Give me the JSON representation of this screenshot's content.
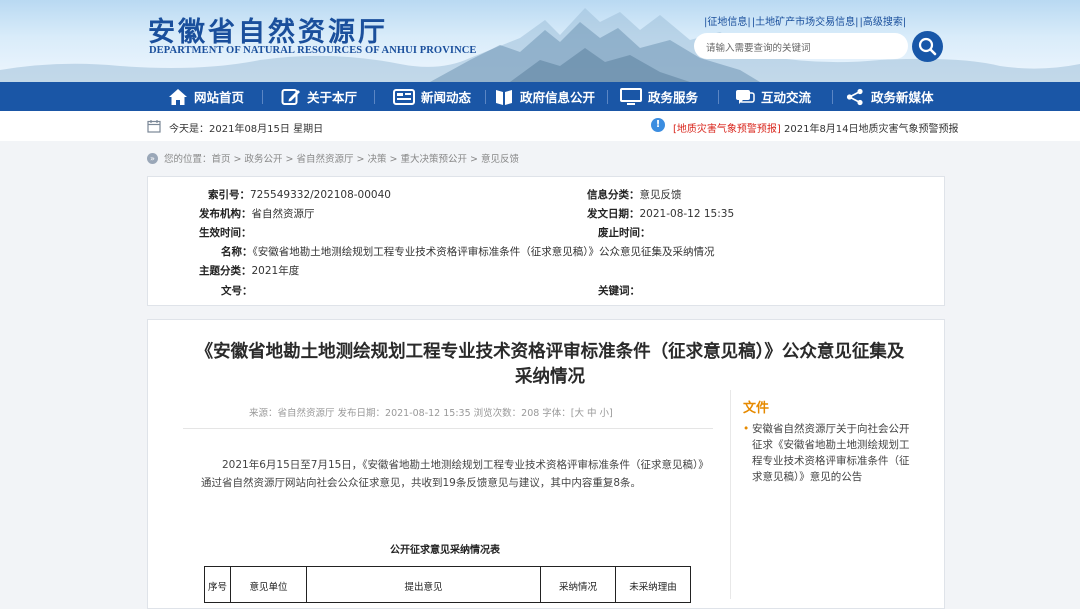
{
  "header": {
    "title_cn": "安徽省自然资源厅",
    "title_en": "DEPARTMENT OF NATURAL RESOURCES OF ANHUI PROVINCE",
    "links": [
      "|征地信息|",
      "|土地矿产市场交易信息|",
      "|高级搜索|"
    ],
    "search_placeholder": "请输入需要查询的关键词"
  },
  "nav": {
    "items": [
      {
        "label": "网站首页",
        "icon": "home-icon"
      },
      {
        "label": "关于本厅",
        "icon": "edit-icon"
      },
      {
        "label": "新闻动态",
        "icon": "news-icon"
      },
      {
        "label": "政府信息公开",
        "icon": "book-icon"
      },
      {
        "label": "政务服务",
        "icon": "monitor-icon"
      },
      {
        "label": "互动交流",
        "icon": "chat-icon"
      },
      {
        "label": "政务新媒体",
        "icon": "share-icon"
      }
    ]
  },
  "info": {
    "date": "今天是：2021年08月15日 星期日",
    "alert_tag": "[地质灾害气象预警预报]",
    "alert_text": " 2021年8月14日地质灾害气象预警预报"
  },
  "breadcrumb": "您的位置：首页 > 政务公开 > 省自然资源厅 > 决策 > 重大决策预公开 > 意见反馈",
  "meta": {
    "index_label": "索引号：",
    "index_value": "725549332/202108-00040",
    "category_label": "信息分类：",
    "category_value": "意见反馈",
    "org_label": "发布机构：",
    "org_value": "省自然资源厅",
    "date_label": "发文日期：",
    "date_value": "2021-08-12 15:35",
    "effective_label": "生效时间：",
    "effective_value": "",
    "repeal_label": "废止时间：",
    "repeal_value": "",
    "name_label": "名称：",
    "name_value": "《安徽省地勘土地测绘规划工程专业技术资格评审标准条件（征求意见稿）》公众意见征集及采纳情况",
    "topic_label": "主题分类：",
    "topic_value": "2021年度",
    "docno_label": "文号：",
    "docno_value": "",
    "keywords_label": "关键词：",
    "keywords_value": ""
  },
  "article": {
    "title": "《安徽省地勘土地测绘规划工程专业技术资格评审标准条件（征求意见稿）》公众意见征集及采纳情况",
    "subline": "来源：省自然资源厅    发布日期：2021-08-12 15:35    浏览次数：208    字体：[大 中 小]",
    "paragraph": "2021年6月15日至7月15日，《安徽省地勘土地测绘规划工程专业技术资格评审标准条件（征求意见稿）》通过省自然资源厅网站向社会公众征求意见，共收到19条反馈意见与建议，其中内容重复8条。",
    "table_title": "公开征求意见采纳情况表",
    "table_headers": [
      "序号",
      "意见单位",
      "提出意见",
      "采纳情况",
      "未采纳理由"
    ]
  },
  "sidebar": {
    "heading": "文件",
    "item": "安徽省自然资源厅关于向社会公开征求《安徽省地勘土地测绘规划工程专业技术资格评审标准条件（征求意见稿）》意见的公告"
  },
  "colors": {
    "nav_bg": "#1a56a6",
    "accent_orange": "#e68a00",
    "alert_red": "#d9261c"
  }
}
